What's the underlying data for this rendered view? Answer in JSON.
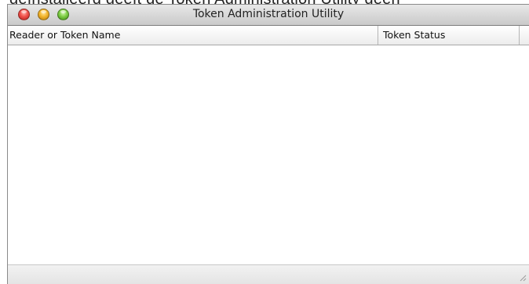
{
  "background_text": "geïnstalleerd geeft de Token Administration Utility geen",
  "window": {
    "title": "Token Administration Utility"
  },
  "table": {
    "columns": [
      "Reader or Token Name",
      "Token Status"
    ],
    "rows": []
  },
  "colors": {
    "close": "#f0504a",
    "minimize": "#f4b62d",
    "zoom": "#7fce46"
  }
}
